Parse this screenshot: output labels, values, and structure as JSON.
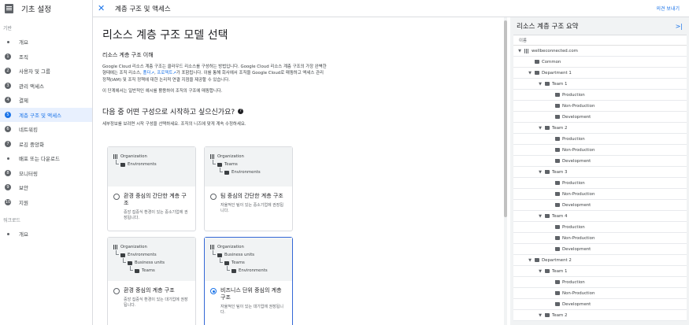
{
  "sidebar": {
    "title": "기초 설정",
    "section_basic": "기반",
    "section_workload": "워크로드",
    "items": [
      {
        "marker": "dot",
        "label": "개요"
      },
      {
        "marker": "1",
        "label": "조직"
      },
      {
        "marker": "2",
        "label": "사용자 및 그룹"
      },
      {
        "marker": "3",
        "label": "관리 액세스"
      },
      {
        "marker": "4",
        "label": "결제"
      },
      {
        "marker": "5",
        "label": "계층 구조 및 액세스",
        "active": true
      },
      {
        "marker": "6",
        "label": "네트워킹"
      },
      {
        "marker": "7",
        "label": "로깅 중앙화"
      },
      {
        "marker": "dot",
        "label": "배포 또는 다운로드"
      },
      {
        "marker": "8",
        "label": "모니터링"
      },
      {
        "marker": "9",
        "label": "보안"
      },
      {
        "marker": "10",
        "label": "지원"
      }
    ],
    "workload_items": [
      {
        "marker": "dot",
        "label": "개요"
      }
    ]
  },
  "topbar": {
    "close_icon": "close-icon",
    "title": "계층 구조 및 액세스",
    "feedback": "의견 보내기"
  },
  "main": {
    "heading": "리소스 계층 구조 모델 선택",
    "subheading": "리소스 계층 구조 이해",
    "para1_a": "Google Cloud 리소스 계층 구조는 클라우드 리소스를 구성하는 방법입니다. Google Cloud 리소스 계층 구조의 가장 완벽한 형태에는 조직 리소스, ",
    "link_folder": "폴더",
    "para1_sep": ", ",
    "link_project": "프로젝트",
    "para1_b": "가 포함됩니다. 이를 통해 회사에서 조직을 Google Cloud로 매핑하고 액세스 관리 정책(IAM) 및 조직 정책에 대한 논리적 연결 지점을 제공할 수 있습니다.",
    "para2": "이 단계에서는 일반적인 예시를 활용하여 조직의 구조에 매핑합니다.",
    "question": "다음 중 어떤 구성으로 시작하고 싶으신가요?",
    "sub": "세부정보를 보려면 시작 구성을 선택하세요. 조직의 니즈에 맞게 계속 수정하세요.",
    "cards": [
      {
        "tree": [
          "Organization",
          "Environments"
        ],
        "title": "환경 중심의 간단한 계층 구조",
        "desc": "중앙 집중식 환경이 있는 중소기업에 권장됩니다.",
        "selected": false
      },
      {
        "tree": [
          "Organization",
          "Teams",
          "Environments"
        ],
        "title": "팀 중심의 간단한 계층 구조",
        "desc": "자율적인 팀이 있는 중소기업에 권장됩니다.",
        "selected": false
      },
      {
        "tree": [
          "Organization",
          "Environments",
          "Business units",
          "Teams"
        ],
        "title": "환경 중심의 계층 구조",
        "desc": "중앙 집중식 환경이 있는 대기업에 권장됩니다.",
        "selected": false
      },
      {
        "tree": [
          "Organization",
          "Business units",
          "Teams",
          "Environments"
        ],
        "title": "비즈니스 단위 중심의 계층 구조",
        "desc": "자율적인 팀이 있는 대기업에 권장됩니다.",
        "selected": true
      }
    ]
  },
  "summary": {
    "title": "리소스 계층 구조 요약",
    "collapse_icon": "collapse-panel-icon",
    "column_header": "이름",
    "nodes": [
      {
        "label": "wellbeconnected.com",
        "level": 0,
        "icon": "building",
        "expanded": true
      },
      {
        "label": "Common",
        "level": 1,
        "icon": "folder",
        "expanded": null
      },
      {
        "label": "Department 1",
        "level": 1,
        "icon": "folder",
        "expanded": true
      },
      {
        "label": "Team 1",
        "level": 2,
        "icon": "folder",
        "expanded": true
      },
      {
        "label": "Production",
        "level": 3,
        "icon": "folder",
        "expanded": null
      },
      {
        "label": "Non-Production",
        "level": 3,
        "icon": "folder",
        "expanded": null
      },
      {
        "label": "Development",
        "level": 3,
        "icon": "folder",
        "expanded": null
      },
      {
        "label": "Team 2",
        "level": 2,
        "icon": "folder",
        "expanded": true
      },
      {
        "label": "Production",
        "level": 3,
        "icon": "folder",
        "expanded": null
      },
      {
        "label": "Non-Production",
        "level": 3,
        "icon": "folder",
        "expanded": null
      },
      {
        "label": "Development",
        "level": 3,
        "icon": "folder",
        "expanded": null
      },
      {
        "label": "Team 3",
        "level": 2,
        "icon": "folder",
        "expanded": true
      },
      {
        "label": "Production",
        "level": 3,
        "icon": "folder",
        "expanded": null
      },
      {
        "label": "Non-Production",
        "level": 3,
        "icon": "folder",
        "expanded": null
      },
      {
        "label": "Development",
        "level": 3,
        "icon": "folder",
        "expanded": null
      },
      {
        "label": "Team 4",
        "level": 2,
        "icon": "folder",
        "expanded": true
      },
      {
        "label": "Production",
        "level": 3,
        "icon": "folder",
        "expanded": null
      },
      {
        "label": "Non-Production",
        "level": 3,
        "icon": "folder",
        "expanded": null
      },
      {
        "label": "Development",
        "level": 3,
        "icon": "folder",
        "expanded": null
      },
      {
        "label": "Department 2",
        "level": 1,
        "icon": "folder",
        "expanded": true
      },
      {
        "label": "Team 1",
        "level": 2,
        "icon": "folder",
        "expanded": true
      },
      {
        "label": "Production",
        "level": 3,
        "icon": "folder",
        "expanded": null
      },
      {
        "label": "Non-Production",
        "level": 3,
        "icon": "folder",
        "expanded": null
      },
      {
        "label": "Development",
        "level": 3,
        "icon": "folder",
        "expanded": null
      },
      {
        "label": "Team 2",
        "level": 2,
        "icon": "folder",
        "expanded": true
      }
    ]
  },
  "colors": {
    "accent": "#1a73e8",
    "selected_bg": "#e8f0fe",
    "panel_bg": "#f1f3f4"
  }
}
